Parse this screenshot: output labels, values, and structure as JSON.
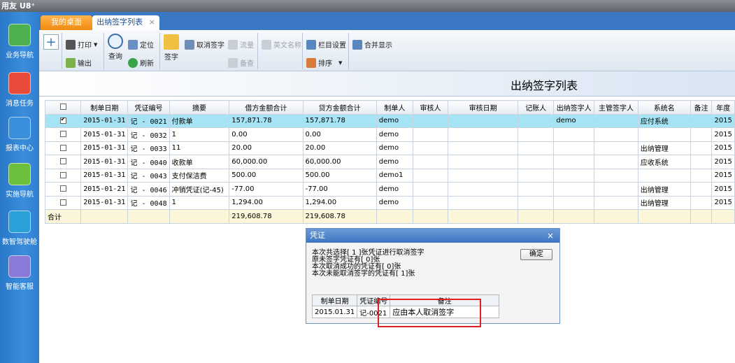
{
  "app": {
    "brand": "用友 U8⁺"
  },
  "sidebar": {
    "items": [
      {
        "label": "业务导航",
        "icon": "business-nav-icon",
        "color": "#4caf50"
      },
      {
        "label": "消息任务",
        "icon": "message-icon",
        "color": "#e84b3a"
      },
      {
        "label": "报表中心",
        "icon": "report-icon",
        "color": "#3a8fdc"
      },
      {
        "label": "实施导航",
        "icon": "implement-icon",
        "color": "#6cbf3a"
      },
      {
        "label": "数智驾驶舱",
        "icon": "cockpit-icon",
        "color": "#2a9fd8"
      },
      {
        "label": "智能客服",
        "icon": "service-icon",
        "color": "#8a7ad8"
      }
    ]
  },
  "tabs": [
    {
      "label": "我的桌面"
    },
    {
      "label": "出纳签字列表",
      "close": "×"
    }
  ],
  "toolbar": {
    "new": "+",
    "print": "打印",
    "export": "输出",
    "query": "查询",
    "locate": "定位",
    "refresh": "刷新",
    "sign": "签字",
    "cancel_sign": "取消签字",
    "flow": "流量",
    "backup": "备查",
    "english": "英文名称",
    "column_setting": "栏目设置",
    "sort": "排序",
    "merge": "合并显示"
  },
  "page": {
    "title": "出纳签字列表"
  },
  "grid": {
    "headers": [
      "制单日期",
      "凭证编号",
      "摘要",
      "借方金额合计",
      "贷方金额合计",
      "制单人",
      "审核人",
      "审核日期",
      "记账人",
      "出纳签字人",
      "主管签字人",
      "系统名",
      "备注",
      "年度"
    ],
    "rows": [
      {
        "checked": true,
        "cells": [
          "2015-01-31",
          "记 - 0021",
          "付款单",
          "157,871.78",
          "157,871.78",
          "demo",
          "",
          "",
          "",
          "demo",
          "",
          "应付系统",
          "",
          "2015"
        ]
      },
      {
        "checked": false,
        "cells": [
          "2015-01-31",
          "记 - 0032",
          "1",
          "0.00",
          "0.00",
          "demo",
          "",
          "",
          "",
          "",
          "",
          "",
          "",
          "2015"
        ]
      },
      {
        "checked": false,
        "cells": [
          "2015-01-31",
          "记 - 0033",
          "11",
          "20.00",
          "20.00",
          "demo",
          "",
          "",
          "",
          "",
          "",
          "出纳管理",
          "",
          "2015"
        ]
      },
      {
        "checked": false,
        "cells": [
          "2015-01-31",
          "记 - 0040",
          "收款单",
          "60,000.00",
          "60,000.00",
          "demo",
          "",
          "",
          "",
          "",
          "",
          "应收系统",
          "",
          "2015"
        ]
      },
      {
        "checked": false,
        "cells": [
          "2015-01-31",
          "记 - 0043",
          "支付保洁费",
          "500.00",
          "500.00",
          "demo1",
          "",
          "",
          "",
          "",
          "",
          "",
          "",
          "2015"
        ]
      },
      {
        "checked": false,
        "cells": [
          "2015-01-21",
          "记 - 0046",
          "冲销凭证(记-45)",
          "-77.00",
          "-77.00",
          "demo",
          "",
          "",
          "",
          "",
          "",
          "出纳管理",
          "",
          "2015"
        ]
      },
      {
        "checked": false,
        "cells": [
          "2015-01-31",
          "记 - 0048",
          "1",
          "1,294.00",
          "1,294.00",
          "demo",
          "",
          "",
          "",
          "",
          "",
          "出纳管理",
          "",
          "2015"
        ]
      }
    ],
    "total": {
      "label": "合计",
      "debit": "219,608.78",
      "credit": "219,608.78"
    }
  },
  "dialog": {
    "title": "凭证",
    "close": "×",
    "ok": "确定",
    "messages": [
      "本次共选择[ 1 ]张凭证进行取消签字",
      "原未签字凭证有[ 0]张",
      "本次取消成功的凭证有[ 0]张",
      "本次未能取消签字的凭证有[ 1]张"
    ],
    "headers": [
      "制单日期",
      "凭证编号",
      "备注"
    ],
    "rows": [
      [
        "2015.01.31",
        "记-0021",
        "应由本人取消签字"
      ]
    ]
  }
}
